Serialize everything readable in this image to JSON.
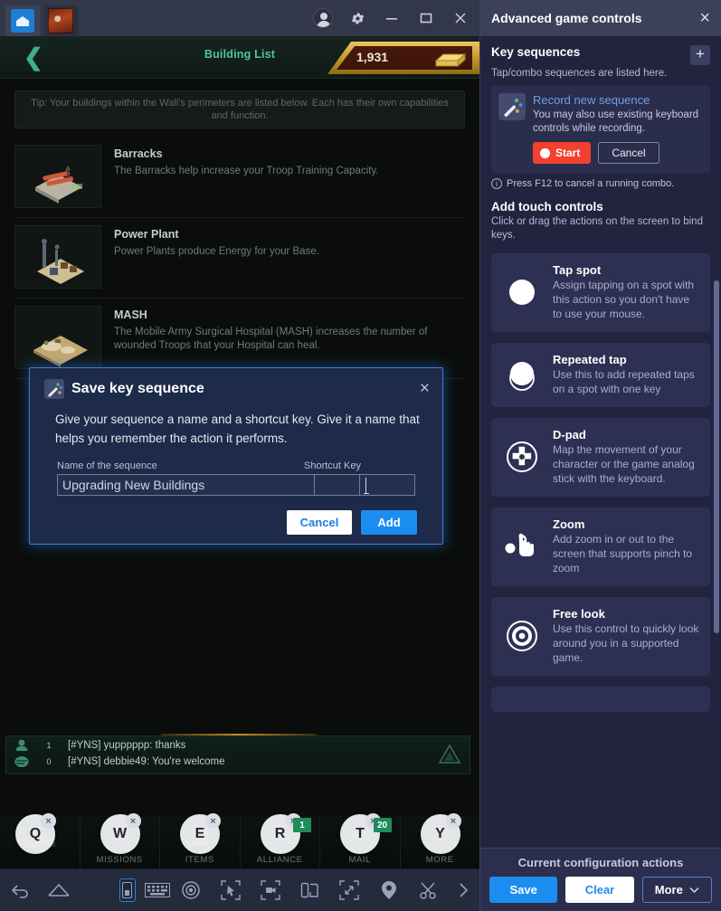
{
  "titlebar": {
    "tabs": [
      {
        "name": "home-tab",
        "icon": "home-icon",
        "active": true
      },
      {
        "name": "game-tab",
        "icon": "game-thumbnail",
        "active": false
      }
    ],
    "controls": [
      {
        "name": "account-avatar",
        "icon": "avatar-icon"
      },
      {
        "name": "settings",
        "icon": "gear-icon"
      },
      {
        "name": "minimize",
        "icon": "minimize-icon"
      },
      {
        "name": "maximize",
        "icon": "maximize-icon"
      },
      {
        "name": "close",
        "icon": "close-icon"
      }
    ]
  },
  "game": {
    "header": {
      "back_icon": "chevron-left-icon",
      "title": "Building List",
      "currency_value": "1,931",
      "currency_icon": "gold-bars-icon"
    },
    "tip": "Tip: Your buildings within the Wall's perimeters are listed below. Each has their own capabilities and function.",
    "buildings": [
      {
        "name": "Barracks",
        "desc": "The Barracks help increase your Troop Training Capacity."
      },
      {
        "name": "Power Plant",
        "desc": "Power Plants produce Energy for your Base."
      },
      {
        "name": "MASH",
        "desc": "The Mobile Army Surgical Hospital (MASH) increases the number of wounded Troops that your Hospital can heal."
      }
    ],
    "chat": {
      "count_1": "1",
      "count_2": "0",
      "line_1": "[#YNS] yupppppp: thanks",
      "line_2": "[#YNS] debbie49: You're welcome"
    },
    "navbar": [
      {
        "label": "",
        "key": "Q",
        "badge": ""
      },
      {
        "label": "MISSIONS",
        "key": "W",
        "badge": ""
      },
      {
        "label": "ITEMS",
        "key": "E",
        "badge": ""
      },
      {
        "label": "ALLIANCE",
        "key": "R",
        "badge": "1"
      },
      {
        "label": "MAIL",
        "key": "T",
        "badge": "20"
      },
      {
        "label": "MORE",
        "key": "Y",
        "badge": ""
      }
    ]
  },
  "bottombar": {
    "icons": [
      {
        "name": "back-icon",
        "selected": false
      },
      {
        "name": "home-icon",
        "selected": false
      },
      {
        "name": "game-controls-icon",
        "selected": true
      },
      {
        "name": "keyboard-icon",
        "selected": false
      },
      {
        "name": "eye-icon",
        "selected": false
      },
      {
        "name": "pointer-select-icon",
        "selected": false
      },
      {
        "name": "record-video-icon",
        "selected": false
      },
      {
        "name": "multi-instance-icon",
        "selected": false
      },
      {
        "name": "fullscreen-icon",
        "selected": false
      },
      {
        "name": "location-pin-icon",
        "selected": false
      },
      {
        "name": "scissors-icon",
        "selected": false
      },
      {
        "name": "chevron-right-icon",
        "selected": false
      }
    ]
  },
  "panel": {
    "title": "Advanced game controls",
    "close_icon": "close-icon",
    "key_sequences": {
      "title": "Key sequences",
      "subtitle": "Tap/combo sequences are listed here.",
      "add_icon": "plus-icon",
      "record": {
        "icon": "magic-wand-icon",
        "title": "Record new sequence",
        "desc": "You may also use existing keyboard controls while recording.",
        "start_label": "Start",
        "cancel_label": "Cancel"
      },
      "hint": "Press F12 to cancel a running combo.",
      "hint_icon": "info-icon"
    },
    "touch_controls": {
      "title": "Add touch controls",
      "subtitle": "Click or drag the actions on the screen to bind keys.",
      "cards": [
        {
          "icon": "tap-spot-icon",
          "name": "Tap spot",
          "desc": "Assign tapping on a spot with this action so you don't have to use your mouse."
        },
        {
          "icon": "repeated-tap-icon",
          "name": "Repeated tap",
          "desc": "Use this to add repeated taps on a spot with one key"
        },
        {
          "icon": "dpad-icon",
          "name": "D-pad",
          "desc": "Map the movement of your character or the game analog stick with the keyboard."
        },
        {
          "icon": "zoom-pinch-icon",
          "name": "Zoom",
          "desc": "Add zoom in or out to the screen that supports pinch to zoom"
        },
        {
          "icon": "free-look-icon",
          "name": "Free look",
          "desc": "Use this control to quickly look around you in a supported game."
        }
      ]
    },
    "footer": {
      "title": "Current configuration actions",
      "save_label": "Save",
      "clear_label": "Clear",
      "more_label": "More",
      "more_icon": "chevron-down-icon"
    }
  },
  "modal": {
    "icon": "magic-wand-icon",
    "title": "Save key sequence",
    "close_icon": "close-icon",
    "body": "Give your sequence a name and a shortcut key. Give it a name that helps you remember the action it performs.",
    "name_label": "Name of the sequence",
    "name_value": "Upgrading New Buildings",
    "name_placeholder": "Name of the sequence",
    "shortcut_label": "Shortcut Key",
    "shortcut_value": "",
    "cancel_label": "Cancel",
    "add_label": "Add"
  }
}
